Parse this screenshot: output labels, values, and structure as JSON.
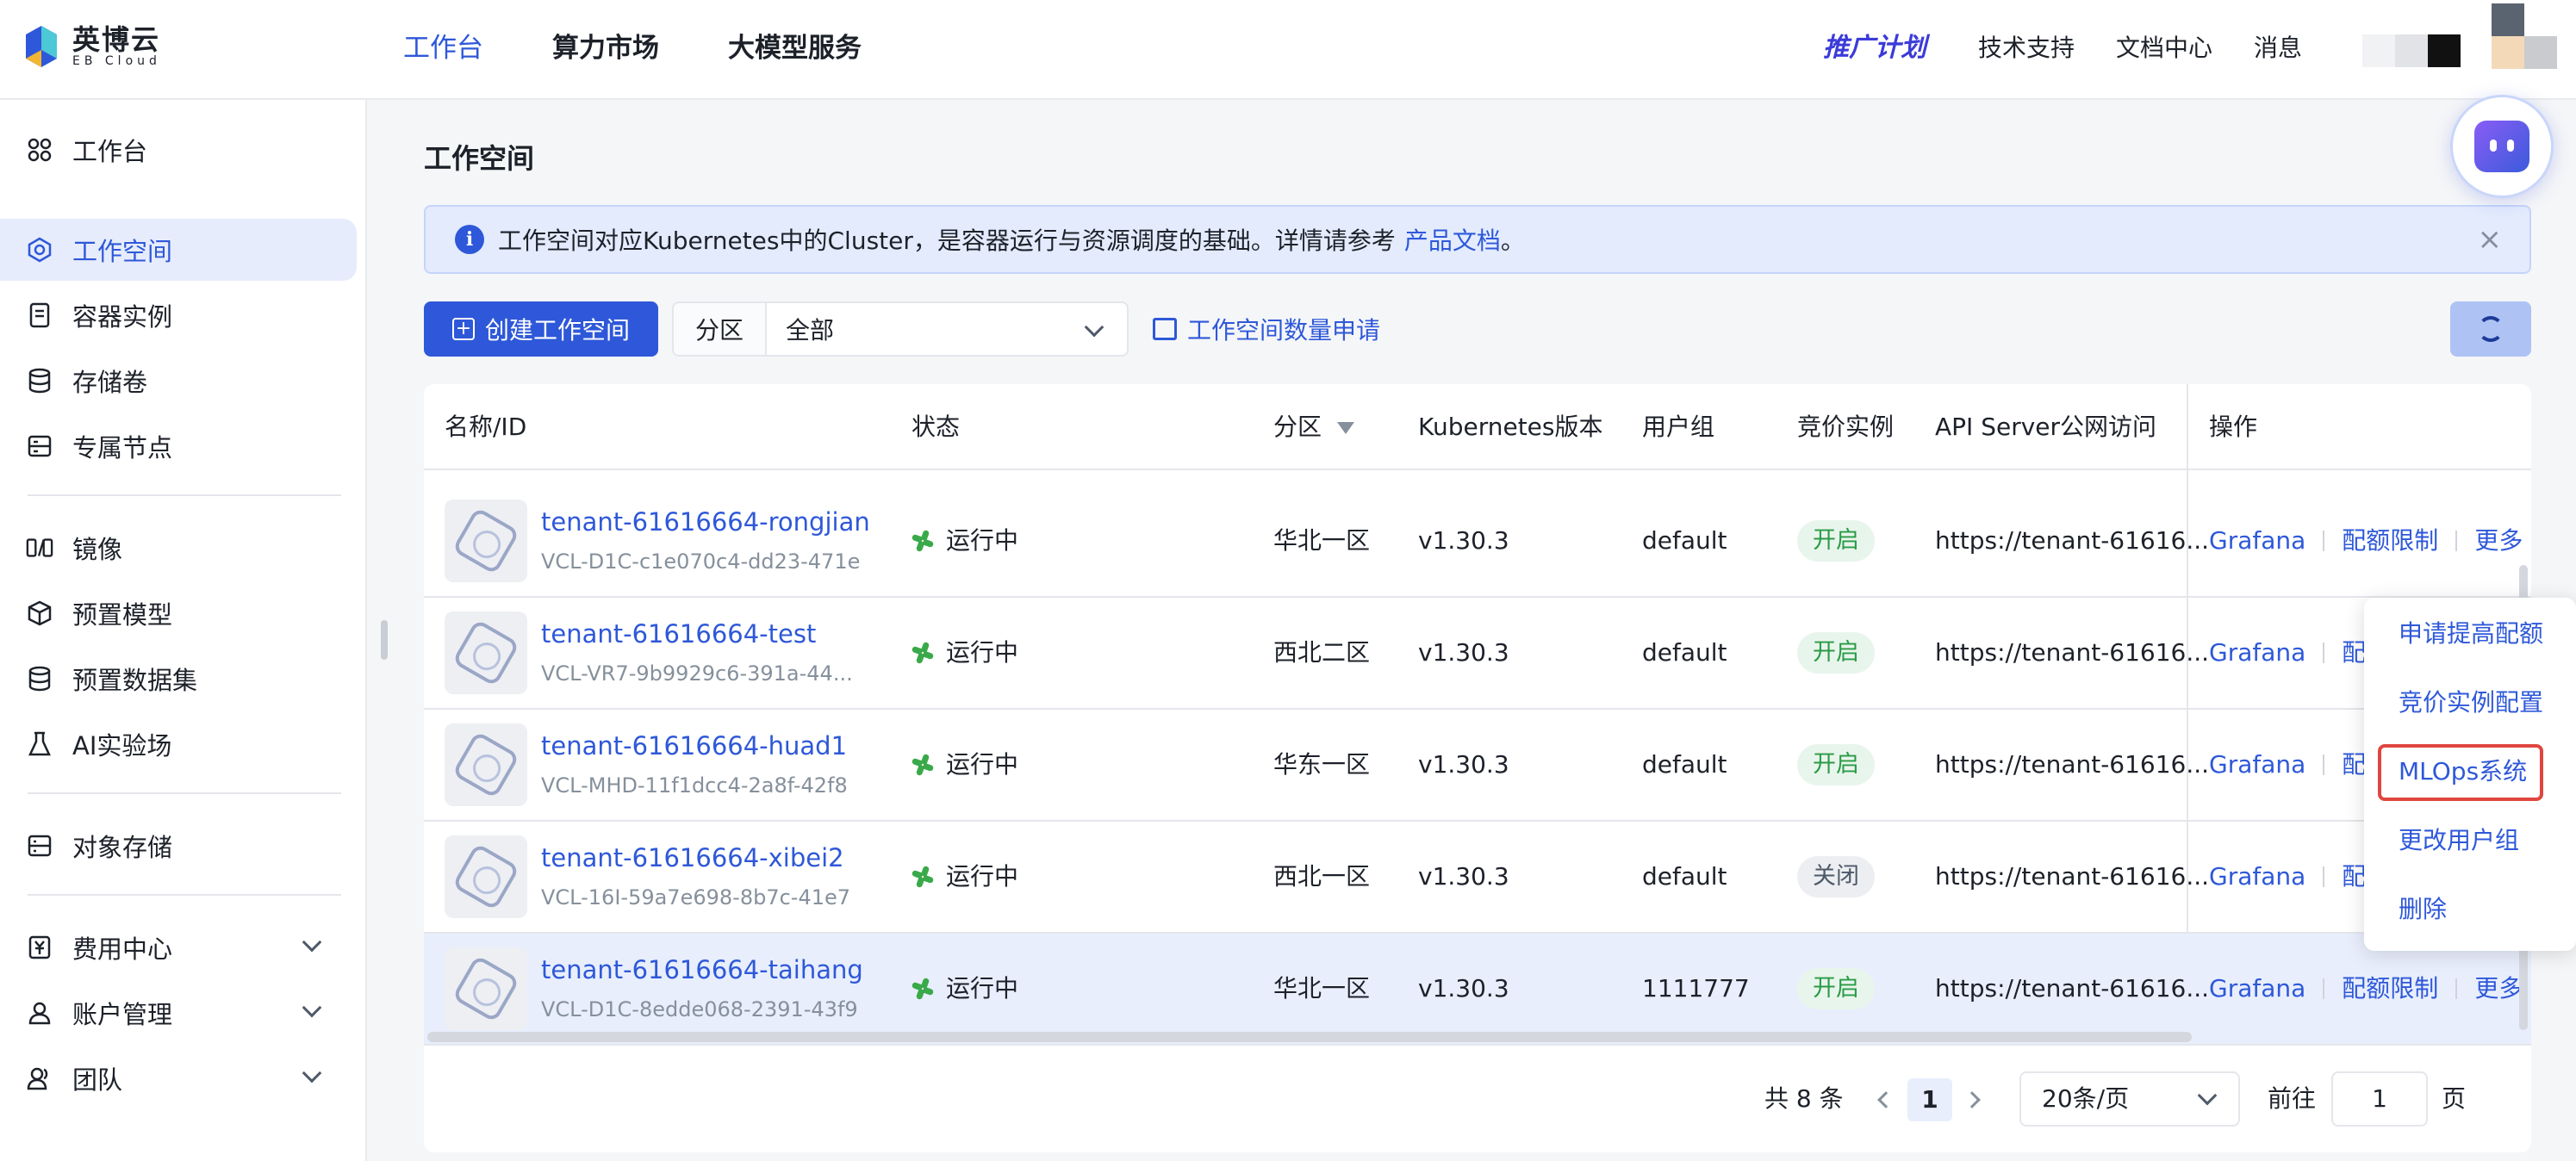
{
  "brand": {
    "name_cn": "英博云",
    "name_en": "EB Cloud",
    "accent": "#2e58d9"
  },
  "topnav": {
    "items": [
      "工作台",
      "算力市场",
      "大模型服务"
    ],
    "active": "工作台",
    "promo": "推广计划",
    "links": [
      "技术支持",
      "文档中心",
      "消息"
    ]
  },
  "sidebar": {
    "items": [
      {
        "label": "工作台",
        "icon": "dashboard-icon"
      },
      {
        "label": "工作空间",
        "icon": "workspace-icon",
        "active": true
      },
      {
        "label": "容器实例",
        "icon": "container-icon"
      },
      {
        "label": "存储卷",
        "icon": "database-icon"
      },
      {
        "label": "专属节点",
        "icon": "server-icon"
      },
      {
        "label": "镜像",
        "icon": "image-icon"
      },
      {
        "label": "预置模型",
        "icon": "cube-icon"
      },
      {
        "label": "预置数据集",
        "icon": "dataset-icon"
      },
      {
        "label": "AI实验场",
        "icon": "flask-icon"
      },
      {
        "label": "对象存储",
        "icon": "bucket-icon"
      },
      {
        "label": "费用中心",
        "icon": "yen-icon"
      },
      {
        "label": "账户管理",
        "icon": "user-icon"
      },
      {
        "label": "团队",
        "icon": "team-icon"
      }
    ]
  },
  "page": {
    "title": "工作空间",
    "notice_text": "工作空间对应Kubernetes中的Cluster，是容器运行与资源调度的基础。详情请参考",
    "notice_link": "产品文档",
    "notice_end": "。"
  },
  "toolbar": {
    "create_label": "创建工作空间",
    "zone_label": "分区",
    "zone_value": "全部",
    "quota_label": "工作空间数量申请"
  },
  "table": {
    "headers": [
      "名称/ID",
      "状态",
      "分区",
      "Kubernetes版本",
      "用户组",
      "竞价实例",
      "API Server公网访问",
      "操作"
    ],
    "rows": [
      {
        "name": "tenant-61616664-rongjian",
        "id": "VCL-D1C-c1e070c4-dd23-471e",
        "status": "运行中",
        "zone": "华北一区",
        "k8s": "v1.30.3",
        "group": "default",
        "bid": "开启",
        "api": "https://tenant-61616...",
        "ops": [
          "Grafana",
          "配额限制",
          "更多"
        ]
      },
      {
        "name": "tenant-61616664-test",
        "id": "VCL-VR7-9b9929c6-391a-44...",
        "status": "运行中",
        "zone": "西北二区",
        "k8s": "v1.30.3",
        "group": "default",
        "bid": "开启",
        "api": "https://tenant-61616...",
        "ops": [
          "Grafana",
          "配额"
        ]
      },
      {
        "name": "tenant-61616664-huad1",
        "id": "VCL-MHD-11f1dcc4-2a8f-42f8",
        "status": "运行中",
        "zone": "华东一区",
        "k8s": "v1.30.3",
        "group": "default",
        "bid": "开启",
        "api": "https://tenant-61616...",
        "ops": [
          "Grafana",
          "配额"
        ]
      },
      {
        "name": "tenant-61616664-xibei2",
        "id": "VCL-16I-59a7e698-8b7c-41e7",
        "status": "运行中",
        "zone": "西北一区",
        "k8s": "v1.30.3",
        "group": "default",
        "bid": "关闭",
        "api": "https://tenant-61616...",
        "ops": [
          "Grafana",
          "配额"
        ]
      },
      {
        "name": "tenant-61616664-taihang",
        "id": "VCL-D1C-8edde068-2391-43f9",
        "status": "运行中",
        "zone": "华北一区",
        "k8s": "v1.30.3",
        "group": "1111777",
        "bid": "开启",
        "api": "https://tenant-61616...",
        "ops": [
          "Grafana",
          "配额限制",
          "更多"
        ]
      }
    ]
  },
  "pagination": {
    "total": "共 8 条",
    "current": "1",
    "page_size": "20条/页",
    "goto_label": "前往",
    "goto_value": "1",
    "page_label": "页"
  },
  "more_menu": {
    "items": [
      "申请提高配额",
      "竞价实例配置",
      "MLOps系统",
      "更改用户组",
      "删除"
    ],
    "highlighted": "MLOps系统"
  }
}
